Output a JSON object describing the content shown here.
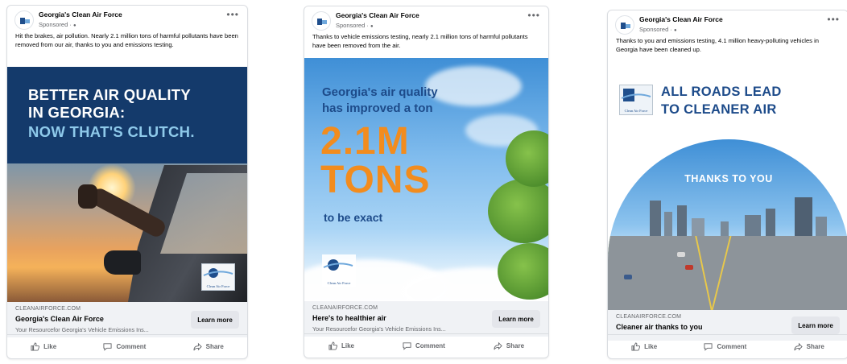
{
  "common": {
    "like_label": "Like",
    "comment_label": "Comment",
    "share_label": "Share",
    "learn_more_label": "Learn more",
    "more_icon": "•••",
    "sponsored_label": "Sponsored · ",
    "globe_icon": "🌐"
  },
  "posts": [
    {
      "page_name": "Georgia's Clean Air Force",
      "caption": "Hit the brakes, air pollution. Nearly 2.1 million tons of harmful pollutants have been removed from our air, thanks to you and emissions testing.",
      "creative": {
        "line1": "BETTER AIR QUALITY",
        "line2": "IN GEORGIA:",
        "line3": "NOW THAT'S CLUTCH.",
        "logo_text": "Clean Air Force"
      },
      "domain": "CLEANAIRFORCE.COM",
      "link_title": "Georgia's Clean Air Force",
      "link_desc": "Your Resourcefor Georgia's Vehicle Emissions Ins..."
    },
    {
      "page_name": "Georgia's Clean Air Force",
      "caption": "Thanks to vehicle emissions testing, nearly 2.1 million tons of harmful pollutants have been removed from the air.",
      "creative": {
        "line1": "Georgia's air quality",
        "line2": "has improved a ton",
        "big1": "2.1M",
        "big2": "TONS",
        "line3": "to be exact",
        "logo_text": "Clean Air Force"
      },
      "domain": "CLEANAIRFORCE.COM",
      "link_title": "Here's to healthier air",
      "link_desc": "Your Resourcefor Georgia's Vehicle Emissions Ins..."
    },
    {
      "page_name": "Georgia's Clean Air Force",
      "caption": "Thanks to you and emissions testing, 4.1 million heavy-polluting vehicles in Georgia have been cleaned up.",
      "creative": {
        "line1": "ALL ROADS LEAD",
        "line2": "TO CLEANER AIR",
        "thanks": "THANKS TO YOU",
        "logo_text": "Clean Air Force"
      },
      "domain": "CLEANAIRFORCE.COM",
      "link_title": "Cleaner air thanks to you",
      "link_desc": ""
    }
  ],
  "colors": {
    "facebook_gray": "#65676b",
    "brand_navy": "#143a6b",
    "brand_blue": "#1d4b8a",
    "accent_orange": "#f28c1e",
    "accent_light_blue": "#8ec9ea"
  }
}
